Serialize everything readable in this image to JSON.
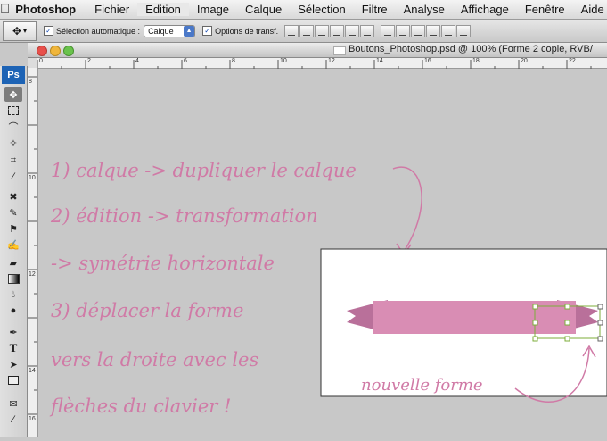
{
  "menubar": {
    "apple": "",
    "app": "Photoshop",
    "items": [
      "Fichier",
      "Edition",
      "Image",
      "Calque",
      "Sélection",
      "Filtre",
      "Analyse",
      "Affichage",
      "Fenêtre",
      "Aide"
    ]
  },
  "options": {
    "auto_select_label": "Sélection automatique :",
    "auto_select_value": "Calque",
    "transform_label": "Options de transf."
  },
  "toolbox": {
    "logo": "Ps",
    "tools": [
      "move-icon",
      "marquee-icon",
      "lasso-icon",
      "magic-wand-icon",
      "crop-icon",
      "eyedropper-icon",
      "healing-icon",
      "brush-icon",
      "stamp-icon",
      "history-brush-icon",
      "eraser-icon",
      "gradient-icon",
      "blur-icon",
      "dodge-icon",
      "pen-icon",
      "type-icon",
      "path-select-icon",
      "shape-icon",
      "notes-icon",
      "zoom-icon"
    ]
  },
  "document": {
    "title": "Boutons_Photoshop.psd @ 100% (Forme 2 copie, RVB/"
  },
  "rulers": {
    "top_labels": [
      "0",
      "2",
      "4",
      "6",
      "8",
      "10",
      "12",
      "14",
      "16",
      "18",
      "20",
      "22"
    ],
    "left_labels": [
      "8",
      "10",
      "12",
      "14",
      "16"
    ]
  },
  "annotations": {
    "line1": "1) calque -> dupliquer le calque",
    "line2": "2) édition -> transformation",
    "line3": "-> symétrie horizontale",
    "line4": "3) déplacer la forme",
    "line5": "vers la droite avec les",
    "line6": "flèches du clavier !",
    "label": "nouvelle forme"
  },
  "colors": {
    "handwriting": "#d07aa6",
    "ribbon_main": "#d98db4",
    "ribbon_dark": "#b9709a",
    "canvas_bg": "#c8c8c8",
    "handle": "#7cae3a"
  }
}
